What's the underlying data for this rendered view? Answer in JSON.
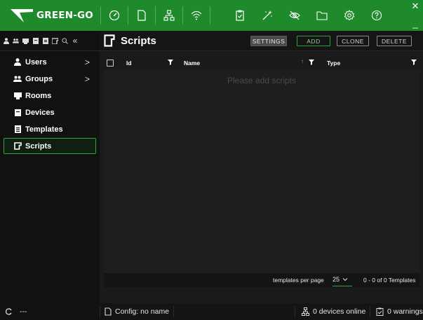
{
  "app": {
    "logo_text": "GREEN-GO",
    "window_close": "✕",
    "window_minimize": "_"
  },
  "toolbar_icons": [
    "dashboard-icon",
    "document-icon",
    "network-icon",
    "wifi-icon",
    "clipboard-icon",
    "magic-wand-icon",
    "eye-off-icon",
    "folder-icon",
    "gear-icon",
    "help-icon"
  ],
  "left_tools": [
    "user-icon",
    "group-icon",
    "room-icon",
    "device-icon",
    "template-icon",
    "script-icon",
    "search-icon",
    "collapse-icon"
  ],
  "collapse_label": "«",
  "sidebar": {
    "items": [
      {
        "label": "Users",
        "icon": "user-icon",
        "chevron": ">"
      },
      {
        "label": "Groups",
        "icon": "group-icon",
        "chevron": ">"
      },
      {
        "label": "Rooms",
        "icon": "room-icon"
      },
      {
        "label": "Devices",
        "icon": "device-icon"
      },
      {
        "label": "Templates",
        "icon": "template-icon"
      },
      {
        "label": "Scripts",
        "icon": "script-icon",
        "active": true
      }
    ]
  },
  "main": {
    "title": "Scripts",
    "buttons": {
      "settings": "SETTINGS",
      "add": "ADD",
      "clone": "CLONE",
      "delete": "DELETE"
    },
    "table": {
      "columns": {
        "id": "Id",
        "name": "Name",
        "type": "Type"
      },
      "sort_indicator": "↑",
      "empty_message": "Please add scripts",
      "footer": {
        "per_page_label": "templates per page",
        "per_page_value": "25",
        "range": "0 - 0 of 0 Templates"
      }
    }
  },
  "status_bar": {
    "left_text": "---",
    "config": "Config: no name",
    "devices_online": "0 devices online",
    "warnings": "0 warnings"
  },
  "colors": {
    "brand_green": "#1f8a2c",
    "accent_green": "#2fa33d"
  }
}
